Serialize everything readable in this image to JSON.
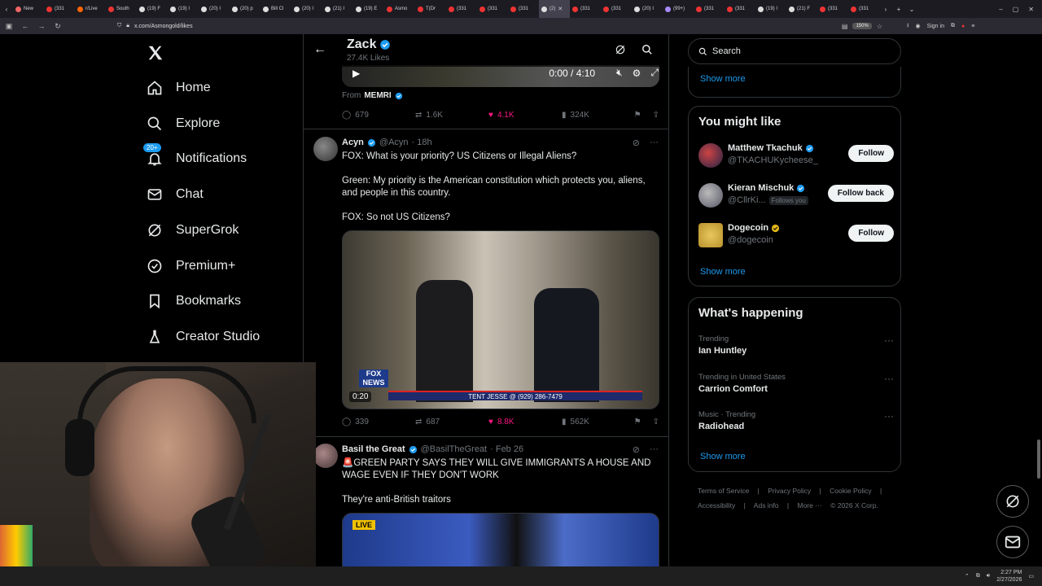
{
  "browser": {
    "tabs": [
      {
        "label": "New",
        "color": "#e66"
      },
      {
        "label": "(331",
        "color": "#e33"
      },
      {
        "label": "r/Live",
        "color": "#f60"
      },
      {
        "label": "South",
        "color": "#e33"
      },
      {
        "label": "(19) F",
        "color": "#ddd"
      },
      {
        "label": "(19) I",
        "color": "#ddd"
      },
      {
        "label": "(20) I",
        "color": "#ddd"
      },
      {
        "label": "(20) p",
        "color": "#ddd"
      },
      {
        "label": "Bill Cl",
        "color": "#ddd"
      },
      {
        "label": "(20) I",
        "color": "#ddd"
      },
      {
        "label": "(21) I",
        "color": "#ddd"
      },
      {
        "label": "(19) E",
        "color": "#ddd"
      },
      {
        "label": "Asmo",
        "color": "#e33"
      },
      {
        "label": "T(Dr",
        "color": "#e33"
      },
      {
        "label": "(331",
        "color": "#e33"
      },
      {
        "label": "(331",
        "color": "#e33"
      },
      {
        "label": "(331",
        "color": "#e33"
      },
      {
        "label": "(2)",
        "color": "#ddd",
        "active": true
      },
      {
        "label": "(331",
        "color": "#e33"
      },
      {
        "label": "(331",
        "color": "#e33"
      },
      {
        "label": "(20) I",
        "color": "#ddd"
      },
      {
        "label": "(99+)",
        "color": "#a78bfa"
      },
      {
        "label": "(331",
        "color": "#e33"
      },
      {
        "label": "(331",
        "color": "#e33"
      },
      {
        "label": "(19) I",
        "color": "#ddd"
      },
      {
        "label": "(21) F",
        "color": "#ddd"
      },
      {
        "label": "(331",
        "color": "#e33"
      },
      {
        "label": "(331",
        "color": "#e33"
      }
    ],
    "url": "x.com/Asmongold/likes",
    "zoom": "150%",
    "signin": "Sign in"
  },
  "nav": {
    "items": [
      {
        "label": "Home"
      },
      {
        "label": "Explore"
      },
      {
        "label": "Notifications",
        "badge": "20+"
      },
      {
        "label": "Chat"
      },
      {
        "label": "SuperGrok"
      },
      {
        "label": "Premium+"
      },
      {
        "label": "Bookmarks"
      },
      {
        "label": "Creator Studio"
      }
    ]
  },
  "header": {
    "name": "Zack",
    "likes": "27.4K Likes"
  },
  "video1": {
    "time": "0:00 / 4:10",
    "from_label": "From",
    "from_source": "MEMRI",
    "stats": {
      "replies": "679",
      "reposts": "1.6K",
      "likes": "4.1K",
      "views": "324K"
    }
  },
  "tweet1": {
    "name": "Acyn",
    "handle": "@Acyn",
    "time": "· 18h",
    "lines": [
      "FOX: What is your priority? US Citizens or Illegal Aliens?",
      "Green: My priority is the American constitution which protects you, aliens, and people in this country.",
      "FOX: So not US Citizens?"
    ],
    "video_time": "0:20",
    "chyron": "TENT JESSE @ (929) 286-7479",
    "stats": {
      "replies": "339",
      "reposts": "687",
      "likes": "8.8K",
      "views": "562K"
    }
  },
  "tweet2": {
    "name": "Basil the Great",
    "handle": "@BasilTheGreat",
    "time": "· Feb 26",
    "text1": "🚨GREEN PARTY SAYS THEY WILL GIVE IMMIGRANTS A HOUSE AND WAGE EVEN IF THEY DON'T WORK",
    "text2": "They're anti-British traitors",
    "live": "LIVE"
  },
  "sidebar": {
    "search_placeholder": "Search",
    "show_more": "Show more",
    "you_might_like": {
      "title": "You might like",
      "people": [
        {
          "name": "Matthew Tkachuk",
          "handle": "@TKACHUKycheese_",
          "button": "Follow",
          "verified": "blue",
          "follows_you": ""
        },
        {
          "name": "Kieran Mischuk",
          "handle": "@CllrKi...",
          "button": "Follow back",
          "verified": "blue",
          "follows_you": "Follows you"
        },
        {
          "name": "Dogecoin",
          "handle": "@dogecoin",
          "button": "Follow",
          "verified": "gold",
          "follows_you": ""
        }
      ]
    },
    "whats_happening": {
      "title": "What's happening",
      "trends": [
        {
          "context": "Trending",
          "name": "Ian Huntley"
        },
        {
          "context": "Trending in United States",
          "name": "Carrion Comfort"
        },
        {
          "context": "Music · Trending",
          "name": "Radiohead"
        }
      ]
    },
    "footer": {
      "links": [
        "Terms of Service",
        "|",
        "Privacy Policy",
        "|",
        "Cookie Policy",
        "|",
        "Accessibility",
        "|",
        "Ads info",
        "|",
        "More ···",
        "© 2026 X Corp."
      ]
    }
  },
  "taskbar": {
    "time": "2:27 PM",
    "date": "2/27/2026"
  },
  "colors": {
    "accent": "#1d9bf0",
    "like": "#f91880",
    "muted": "#71767b",
    "border": "#2f3336"
  }
}
